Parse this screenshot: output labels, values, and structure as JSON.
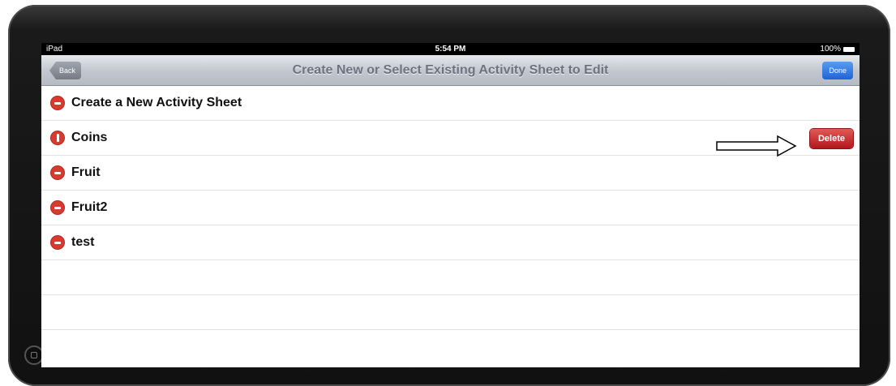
{
  "status_bar": {
    "device": "iPad",
    "time": "5:54 PM",
    "battery": "100%"
  },
  "nav_bar": {
    "back_label": "Back",
    "title": "Create New or Select Existing Activity Sheet to Edit",
    "done_label": "Done"
  },
  "rows": [
    {
      "label": "Create a New Activity Sheet",
      "icon": "minus-circle-icon"
    },
    {
      "label": "Coins",
      "icon": "rotated-delete-icon",
      "delete_label": "Delete"
    },
    {
      "label": "Fruit",
      "icon": "minus-circle-icon"
    },
    {
      "label": "Fruit2",
      "icon": "minus-circle-icon"
    },
    {
      "label": "test",
      "icon": "minus-circle-icon"
    }
  ]
}
